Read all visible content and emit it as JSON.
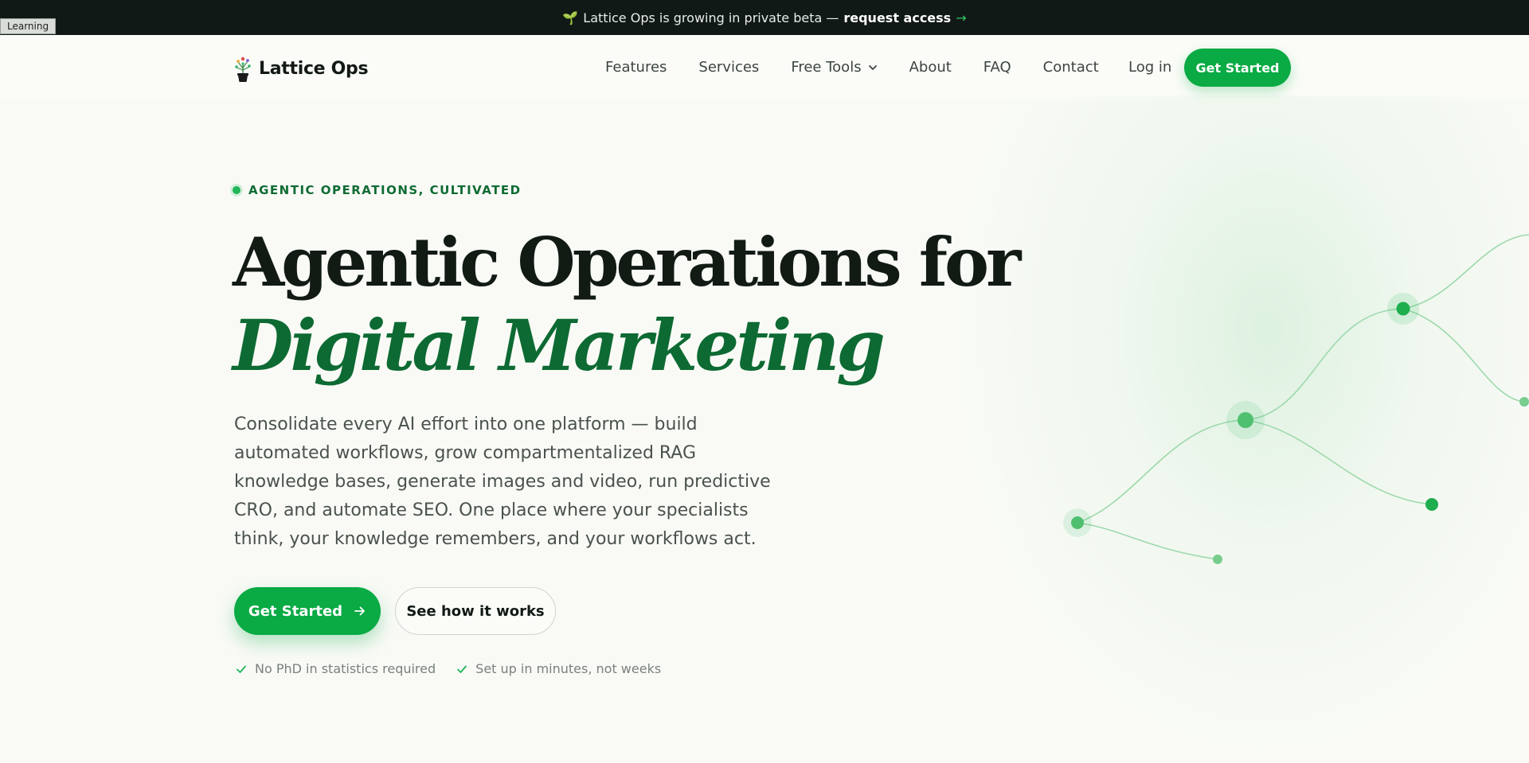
{
  "announcement": {
    "text": "Lattice Ops is growing in private beta —",
    "link": "request access",
    "arrow": "→",
    "icon": "sprout-icon"
  },
  "debug_tag": "Learning",
  "brand": {
    "name": "Lattice Ops",
    "logo": "potted-plant-icon"
  },
  "nav": {
    "links": [
      "Features",
      "Services",
      "Free Tools",
      "About",
      "FAQ",
      "Contact"
    ],
    "login": "Log in",
    "cta": "Get Started"
  },
  "hero": {
    "eyebrow": "AGENTIC OPERATIONS, CULTIVATED",
    "headline_line1": "Agentic Operations for",
    "headline_line2": "Digital Marketing",
    "lead": "Consolidate every AI effort into one platform — build automated workflows, grow compartmentalized RAG knowledge bases, generate images and video, run predictive CRO, and automate SEO. One place where your specialists think, your knowledge remembers, and your workflows act.",
    "primary_cta": "Get Started",
    "secondary_cta": "See how it works",
    "assurances": [
      "No PhD in statistics required",
      "Set up in minutes, not weeks"
    ]
  },
  "colors": {
    "accent": "#0aaa44",
    "accent_dark": "#0d6a32",
    "topbar_bg": "#111916",
    "page_bg": "#f9faf6"
  }
}
